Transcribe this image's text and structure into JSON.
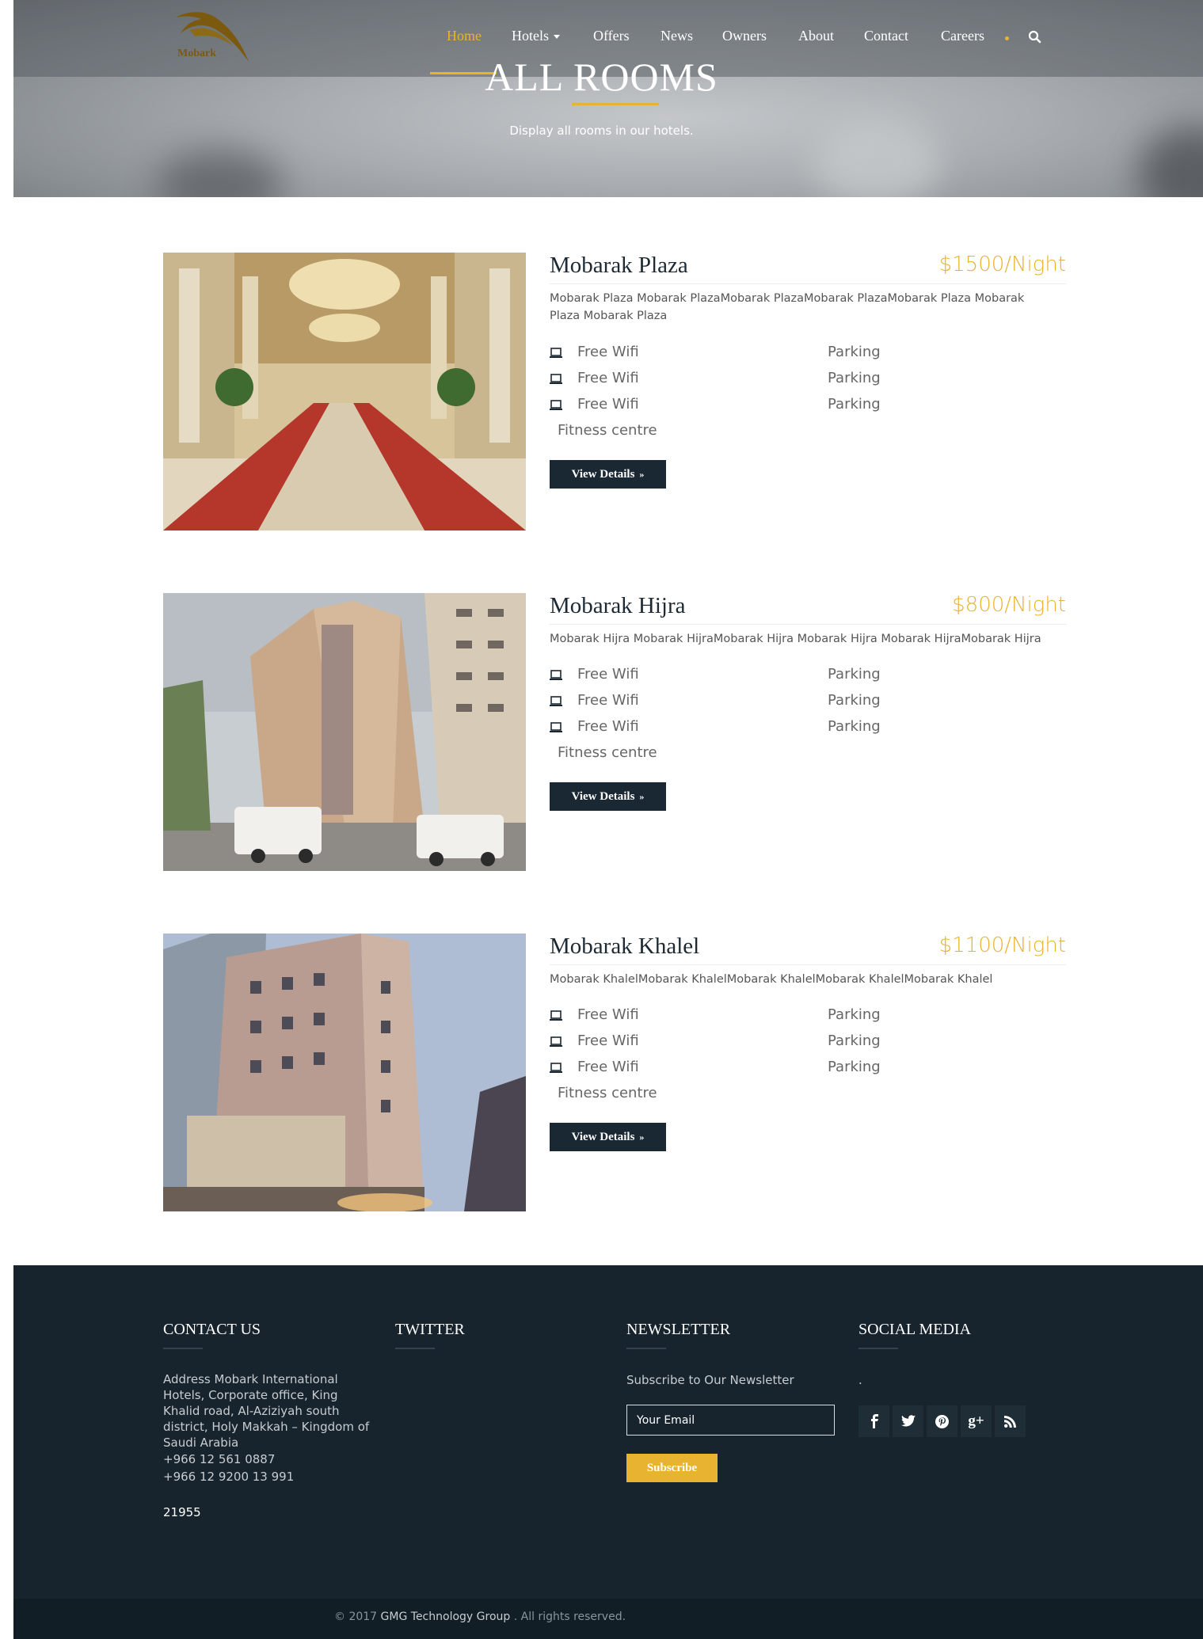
{
  "brand": {
    "logo_text": "Mobark"
  },
  "nav": {
    "items": [
      {
        "label": "Home",
        "active": true
      },
      {
        "label": "Hotels",
        "dropdown": true
      },
      {
        "label": "Offers"
      },
      {
        "label": "News"
      },
      {
        "label": "Owners"
      },
      {
        "label": "About"
      },
      {
        "label": "Contact"
      },
      {
        "label": "Careers"
      }
    ],
    "search_icon": "search-icon"
  },
  "hero": {
    "title": "ALL ROOMS",
    "subtitle": "Display all rooms in our hotels."
  },
  "rooms": [
    {
      "name": "Mobarak Plaza",
      "price": "$1500/Night",
      "description": "Mobarak Plaza Mobarak PlazaMobarak PlazaMobarak PlazaMobarak Plaza Mobarak Plaza Mobarak Plaza",
      "amenities_left": [
        "Free Wifi",
        "Free Wifi",
        "Free Wifi"
      ],
      "amenities_right": [
        "Parking",
        "Parking",
        "Parking"
      ],
      "amenity_extra": "Fitness centre",
      "button": "View Details"
    },
    {
      "name": "Mobarak Hijra",
      "price": "$800/Night",
      "description": "Mobarak Hijra Mobarak HijraMobarak Hijra Mobarak Hijra Mobarak HijraMobarak Hijra",
      "amenities_left": [
        "Free Wifi",
        "Free Wifi",
        "Free Wifi"
      ],
      "amenities_right": [
        "Parking",
        "Parking",
        "Parking"
      ],
      "amenity_extra": "Fitness centre",
      "button": "View Details"
    },
    {
      "name": "Mobarak Khalel",
      "price": "$1100/Night",
      "description": "Mobarak KhalelMobarak KhalelMobarak KhalelMobarak KhalelMobarak Khalel",
      "amenities_left": [
        "Free Wifi",
        "Free Wifi",
        "Free Wifi"
      ],
      "amenities_right": [
        "Parking",
        "Parking",
        "Parking"
      ],
      "amenity_extra": "Fitness centre",
      "button": "View Details"
    }
  ],
  "footer": {
    "contact": {
      "title": "CONTACT US",
      "address": "Address Mobark International Hotels, Corporate office, King Khalid road, Al-Aziziyah south district, Holy Makkah – Kingdom of Saudi Arabia",
      "phone1": "+966 12 561 0887",
      "phone2": "+966 12 9200 13 991",
      "postal": "21955"
    },
    "twitter": {
      "title": "TWITTER"
    },
    "newsletter": {
      "title": "NEWSLETTER",
      "label": "Subscribe to Our Newsletter",
      "placeholder": "Your Email",
      "button": "Subscribe"
    },
    "social": {
      "title": "SOCIAL MEDIA",
      "note": ".",
      "icons": [
        "facebook-icon",
        "twitter-icon",
        "pinterest-icon",
        "google-plus-icon",
        "rss-icon"
      ]
    },
    "copyright_prefix": "© 2017",
    "copyright_brand": "GMG Technology Group",
    "copyright_suffix": ". All rights reserved."
  },
  "colors": {
    "accent": "#e8b330",
    "dark": "#1a2833",
    "footer_bg": "#17242d"
  }
}
